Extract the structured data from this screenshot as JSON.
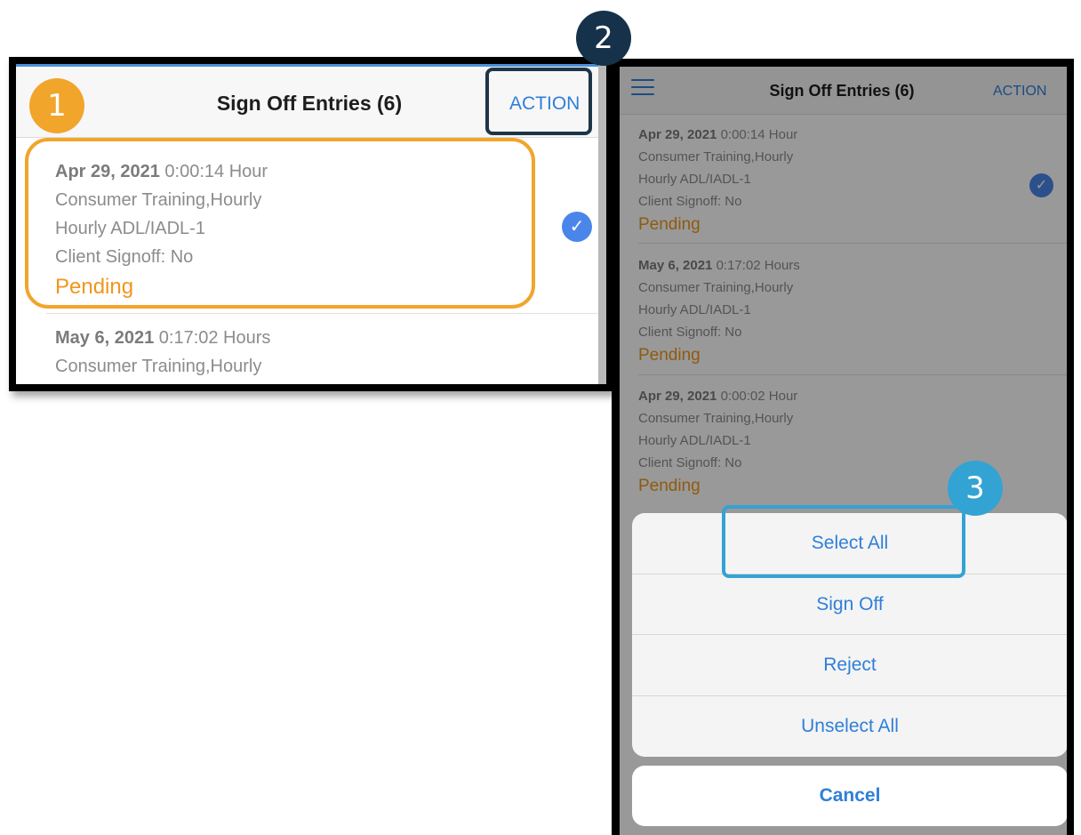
{
  "badges": {
    "step1": "1",
    "step2": "2",
    "step3": "3"
  },
  "header": {
    "title": "Sign Off Entries (6)",
    "action_label": "ACTION"
  },
  "entries": [
    {
      "date": "Apr 29, 2021",
      "duration": "0:00:14 Hour",
      "service": "Consumer Training,Hourly",
      "code": "Hourly ADL/IADL-1",
      "client_signoff": "Client Signoff: No",
      "status": "Pending",
      "selected": true
    },
    {
      "date": "May 6, 2021",
      "duration": "0:17:02 Hours",
      "service": "Consumer Training,Hourly",
      "code": "Hourly ADL/IADL-1",
      "client_signoff": "Client Signoff: No",
      "status": "Pending",
      "selected": false
    },
    {
      "date": "Apr 29, 2021",
      "duration": "0:00:02 Hour",
      "service": "Consumer Training,Hourly",
      "code": "Hourly ADL/IADL-1",
      "client_signoff": "Client Signoff: No",
      "status": "Pending",
      "selected": false
    }
  ],
  "action_sheet": {
    "options": [
      "Select All",
      "Sign Off",
      "Reject",
      "Unselect All"
    ],
    "cancel_label": "Cancel"
  },
  "colors": {
    "accent_blue": "#2f7fd9",
    "pending_orange": "#f0961c",
    "highlight_orange": "#f2a52b",
    "highlight_navy": "#16324a",
    "highlight_cyan": "#33a3d4"
  },
  "icons": {
    "menu": "hamburger-icon",
    "selected": "checkmark-circle-icon"
  }
}
